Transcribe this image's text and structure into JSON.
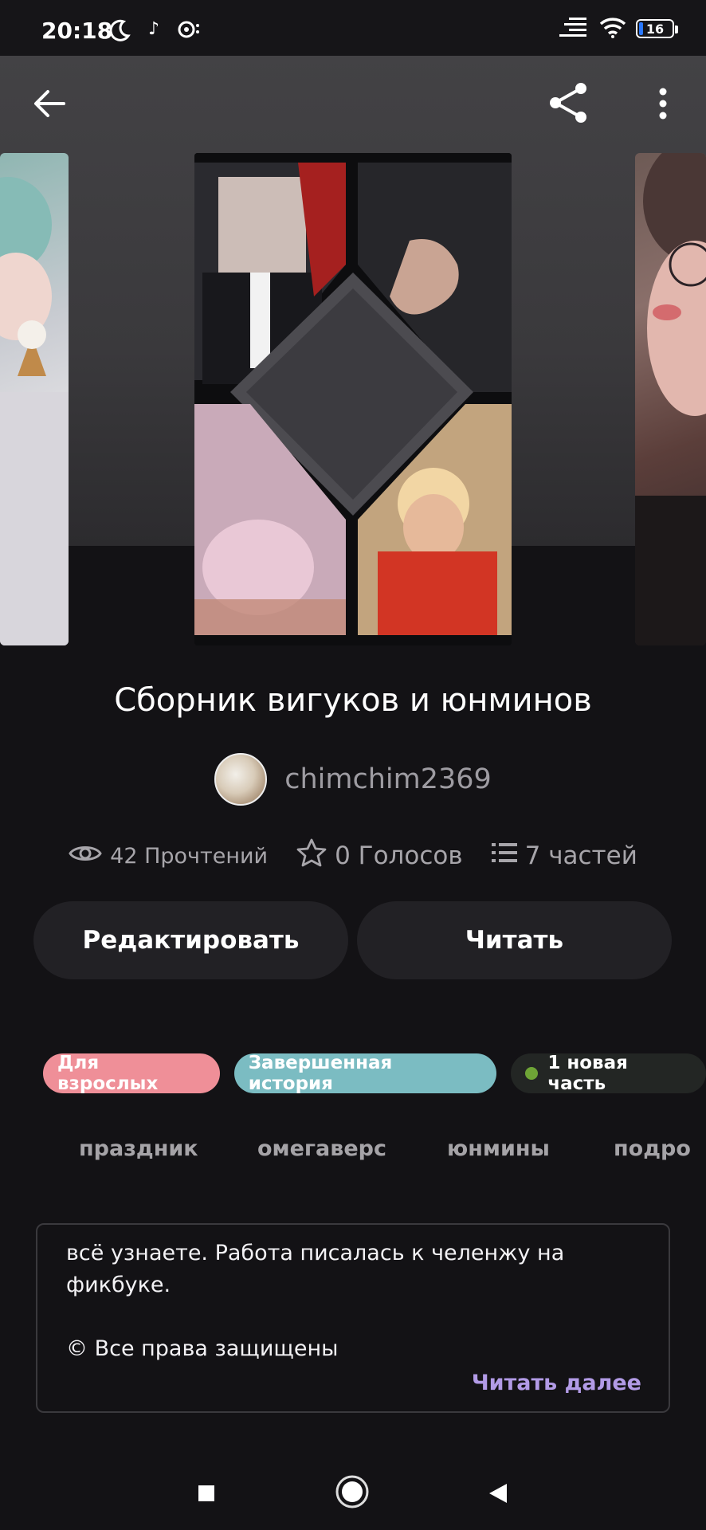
{
  "status_bar": {
    "time": "20:18",
    "battery": "16",
    "icons": [
      "moon-icon",
      "music-note-icon",
      "message-icon",
      "signal-icon",
      "wifi-icon",
      "battery-icon"
    ]
  },
  "toolbar": {
    "icons": [
      "back-arrow-icon",
      "share-icon",
      "more-vertical-icon"
    ]
  },
  "story": {
    "title": "Сборник вигуков и юнминов",
    "author": "chimchim2369",
    "stats": {
      "reads": "42 Прочтений",
      "votes": "0 Голосов",
      "parts": "7 частей"
    },
    "buttons": {
      "edit": "Редактировать",
      "read": "Читать"
    },
    "chips": {
      "adult": "Для взрослых",
      "complete": "Завершенная история",
      "new_part": "1 новая часть"
    },
    "tags": [
      "праздник",
      "омегаверс",
      "юнмины",
      "подро"
    ],
    "description": "всё узнаете. Работа писалась к челенжу на фикбуке.\n\n© Все права защищены",
    "read_more": "Читать далее"
  },
  "colors": {
    "background": "#131215",
    "button_bg": "#222125",
    "chip_adult": "#ef8f98",
    "chip_complete": "#7bbcc2",
    "new_dot": "#6ea436",
    "read_more": "#b29be6"
  }
}
